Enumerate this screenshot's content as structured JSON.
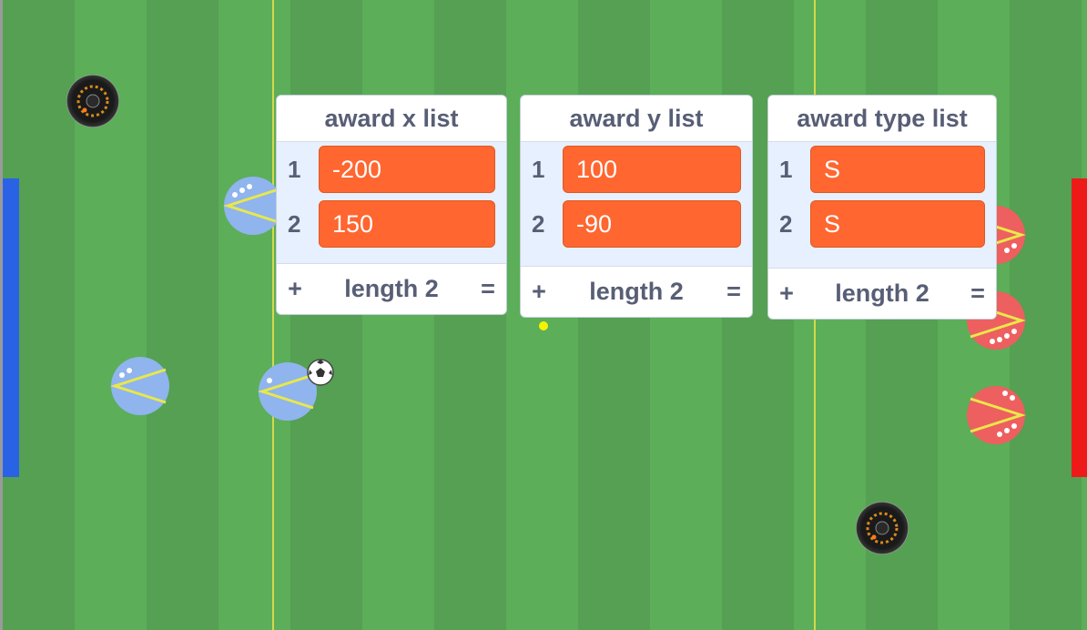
{
  "monitors": [
    {
      "title": "award x list",
      "items": [
        {
          "index": "1",
          "value": "-200"
        },
        {
          "index": "2",
          "value": "150"
        }
      ],
      "length_label": "length 2",
      "add_label": "+",
      "resize_label": "="
    },
    {
      "title": "award y list",
      "items": [
        {
          "index": "1",
          "value": "100"
        },
        {
          "index": "2",
          "value": "-90"
        }
      ],
      "length_label": "length 2",
      "add_label": "+",
      "resize_label": "="
    },
    {
      "title": "award type list",
      "items": [
        {
          "index": "1",
          "value": "S"
        },
        {
          "index": "2",
          "value": "S"
        }
      ],
      "length_label": "length 2",
      "add_label": "+",
      "resize_label": "="
    }
  ],
  "colors": {
    "blue_team": "#8fb4ee",
    "red_team": "#ee5f5f",
    "list_item": "#ff6630",
    "left_goal": "#2a62e6",
    "right_goal": "#ee1a1a"
  },
  "sprites": {
    "goal_left": "blue-goal",
    "goal_right": "red-goal",
    "ball": "soccer-ball-icon",
    "badge": "record-badge-icon",
    "award": "award-marker"
  }
}
